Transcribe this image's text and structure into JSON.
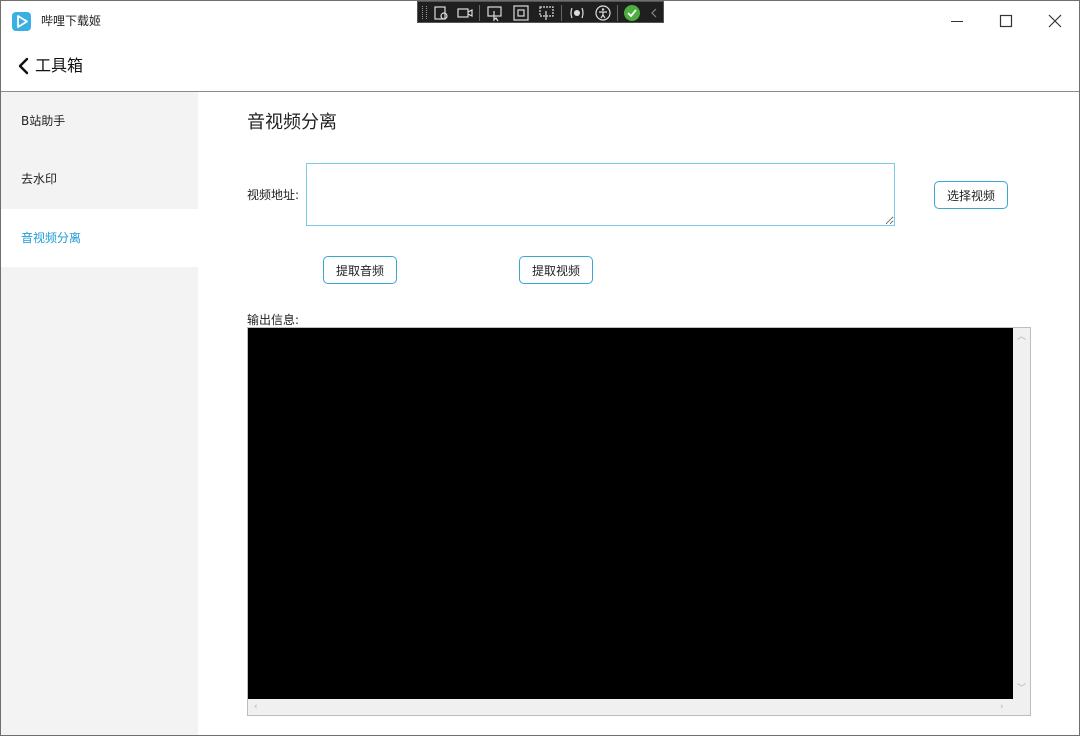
{
  "app": {
    "title": "哔哩下载姬"
  },
  "header": {
    "title": "工具箱"
  },
  "sidebar": {
    "items": [
      {
        "label": "B站助手",
        "active": false
      },
      {
        "label": "去水印",
        "active": false
      },
      {
        "label": "音视频分离",
        "active": true
      }
    ]
  },
  "main": {
    "title": "音视频分离",
    "url_label": "视频地址:",
    "url_value": "",
    "select_button": "选择视频",
    "extract_audio_button": "提取音频",
    "extract_video_button": "提取视频",
    "output_label": "输出信息:",
    "output_text": ""
  },
  "colors": {
    "accent": "#1e9bd6",
    "button_border": "#3aa6d6",
    "output_bg": "#000000",
    "sidebar_bg": "#f3f3f3"
  },
  "icons": [
    "app-logo-icon",
    "back-arrow-icon",
    "minimize-icon",
    "maximize-icon",
    "close-icon"
  ]
}
